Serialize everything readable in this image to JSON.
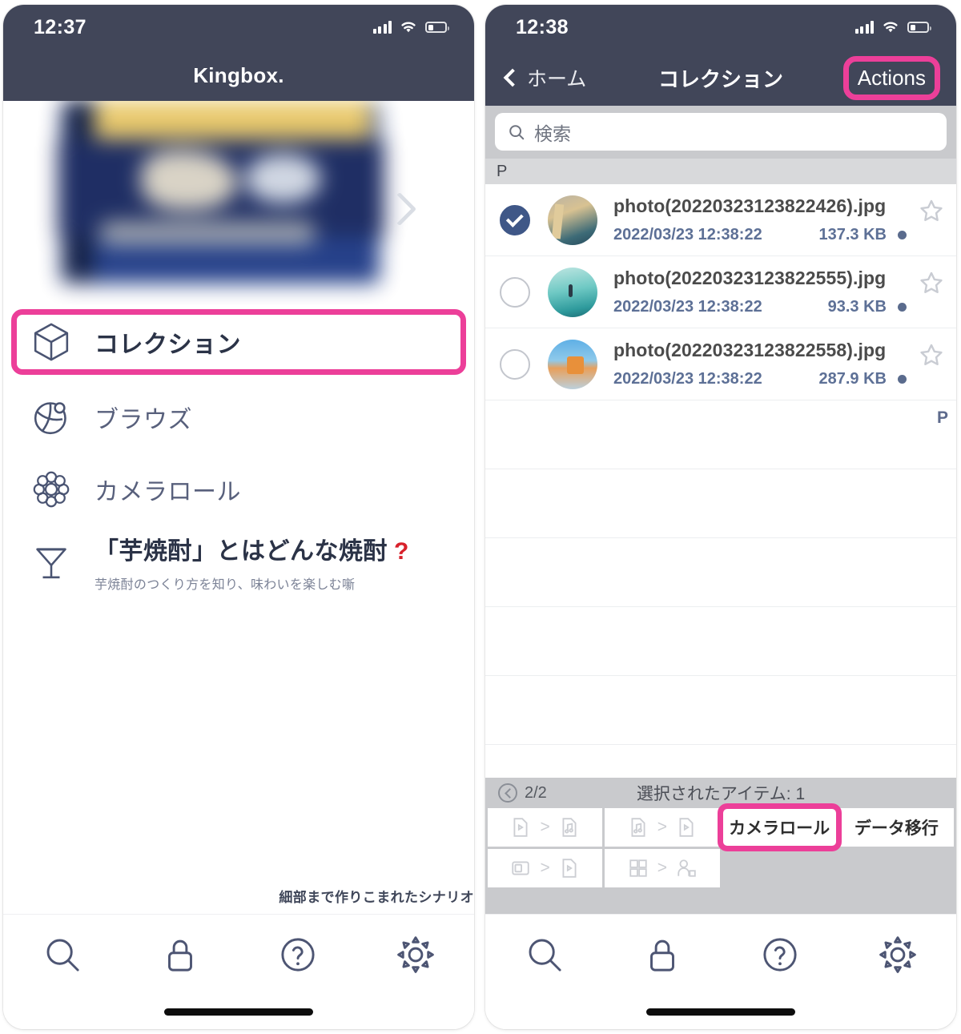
{
  "accent_pink": "#ec3f99",
  "navbar_color": "#414659",
  "left_phone": {
    "status": {
      "time": "12:37"
    },
    "title": "Kingbox.",
    "banner": {
      "alt": "blurred-promo-banner"
    },
    "menu": [
      {
        "label": "コレクション",
        "icon": "cube-icon",
        "highlighted": true
      },
      {
        "label": "ブラウズ",
        "icon": "browse-globe-icon",
        "highlighted": false
      },
      {
        "label": "カメラロール",
        "icon": "flower-photos-icon",
        "highlighted": false
      },
      {
        "label": "「芋焼酎」とはどんな焼酎",
        "suffix": "?",
        "sub": "芋焼酎のつくり方を知り、味わいを楽しむ噺",
        "icon": "cocktail-glass-icon",
        "highlighted": false
      }
    ],
    "promo_footer": "細部まで作りこまれたシナリオ",
    "tabs": [
      {
        "name": "search-tab",
        "icon": "search-icon"
      },
      {
        "name": "lock-tab",
        "icon": "lock-icon"
      },
      {
        "name": "help-tab",
        "icon": "question-circle-icon"
      },
      {
        "name": "settings-tab",
        "icon": "gear-icon"
      }
    ]
  },
  "right_phone": {
    "status": {
      "time": "12:38"
    },
    "nav": {
      "back_label": "ホーム",
      "title": "コレクション",
      "actions_label": "Actions"
    },
    "search": {
      "placeholder": "検索",
      "value": ""
    },
    "section_header": "P",
    "index_letter": "P",
    "files": [
      {
        "name": "photo(20220323123822426).jpg",
        "date": "2022/03/23 12:38:22",
        "size": "137.3 KB",
        "selected": true,
        "starred": false,
        "thumb": "surfboards-photo"
      },
      {
        "name": "photo(20220323123822555).jpg",
        "date": "2022/03/23 12:38:22",
        "size": "93.3 KB",
        "selected": false,
        "starred": false,
        "thumb": "surfer-wave-photo"
      },
      {
        "name": "photo(20220323123822558).jpg",
        "date": "2022/03/23 12:38:22",
        "size": "287.9 KB",
        "selected": false,
        "starred": false,
        "thumb": "truck-reflection-photo"
      }
    ],
    "action_panel": {
      "page": "2/2",
      "selected_text": "選択されたアイテム: 1",
      "buttons": [
        {
          "label": "",
          "icon": "video-to-audio-icon",
          "disabled": true,
          "highlighted": false
        },
        {
          "label": "",
          "icon": "audio-to-video-icon",
          "disabled": true,
          "highlighted": false
        },
        {
          "label": "カメラロール",
          "icon": "",
          "disabled": false,
          "highlighted": true
        },
        {
          "label": "データ移行",
          "icon": "",
          "disabled": false,
          "highlighted": false
        },
        {
          "label": "",
          "icon": "gif-to-video-icon",
          "disabled": true,
          "highlighted": false
        },
        {
          "label": "",
          "icon": "grid-to-person-icon",
          "disabled": true,
          "highlighted": false
        },
        {
          "label": "",
          "icon": "",
          "disabled": true,
          "highlighted": false
        },
        {
          "label": "",
          "icon": "",
          "disabled": true,
          "highlighted": false
        }
      ]
    },
    "tabs": [
      {
        "name": "search-tab",
        "icon": "search-icon"
      },
      {
        "name": "lock-tab",
        "icon": "lock-icon"
      },
      {
        "name": "help-tab",
        "icon": "question-circle-icon"
      },
      {
        "name": "settings-tab",
        "icon": "gear-icon"
      }
    ]
  }
}
